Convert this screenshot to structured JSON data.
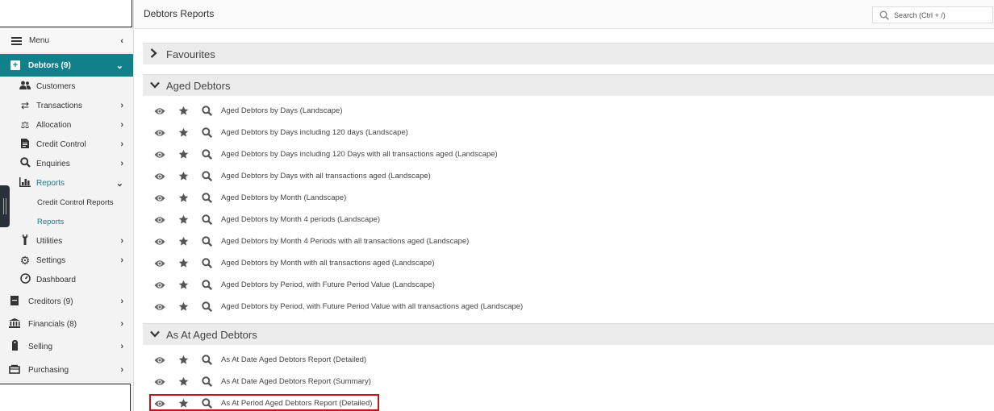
{
  "sidebar": {
    "menu_label": "Menu",
    "debtors_label": "Debtors (9)",
    "debtors_items": [
      {
        "label": "Customers",
        "icon": "users-icon"
      },
      {
        "label": "Transactions",
        "icon": "exchange-icon"
      },
      {
        "label": "Allocation",
        "icon": "balance-scale-icon"
      },
      {
        "label": "Credit Control",
        "icon": "document-icon"
      },
      {
        "label": "Enquiries",
        "icon": "search-icon"
      },
      {
        "label": "Reports",
        "icon": "bar-chart-icon"
      }
    ],
    "reports_sub": [
      "Credit Control Reports",
      "Reports"
    ],
    "more_items": [
      {
        "label": "Utilities",
        "icon": "wrench-icon"
      },
      {
        "label": "Settings",
        "icon": "gear-icon"
      },
      {
        "label": "Dashboard",
        "icon": "dashboard-icon"
      }
    ],
    "sections": [
      {
        "label": "Creditors (9)",
        "icon": "ledger-icon"
      },
      {
        "label": "Financials (8)",
        "icon": "bank-icon"
      },
      {
        "label": "Selling",
        "icon": "tag-icon"
      },
      {
        "label": "Purchasing",
        "icon": "cart-icon"
      }
    ]
  },
  "header": {
    "title": "Debtors Reports",
    "search_placeholder": "Search (Ctrl + /)"
  },
  "groups": {
    "favourites": "Favourites",
    "aged_debtors": "Aged Debtors",
    "as_at_aged_debtors": "As At Aged Debtors"
  },
  "aged_reports": [
    "Aged Debtors by Days (Landscape)",
    "Aged Debtors by Days including 120 days (Landscape)",
    "Aged Debtors by Days including 120 Days with all transactions aged (Landscape)",
    "Aged Debtors by Days with all transactions aged (Landscape)",
    "Aged Debtors by Month (Landscape)",
    "Aged Debtors by Month 4 periods (Landscape)",
    "Aged Debtors by Month 4 Periods with all transactions aged (Landscape)",
    "Aged Debtors by Month with all transactions aged (Landscape)",
    "Aged Debtors by Period, with Future Period Value (Landscape)",
    "Aged Debtors by Period, with Future Period Value with all transactions aged (Landscape)"
  ],
  "as_at_reports": [
    "As At Date Aged Debtors Report (Detailed)",
    "As At Date Aged Debtors Report (Summary)",
    "As At Period Aged Debtors Report (Detailed)"
  ],
  "colors": {
    "accent": "#10808a",
    "highlight": "#c0151f"
  }
}
